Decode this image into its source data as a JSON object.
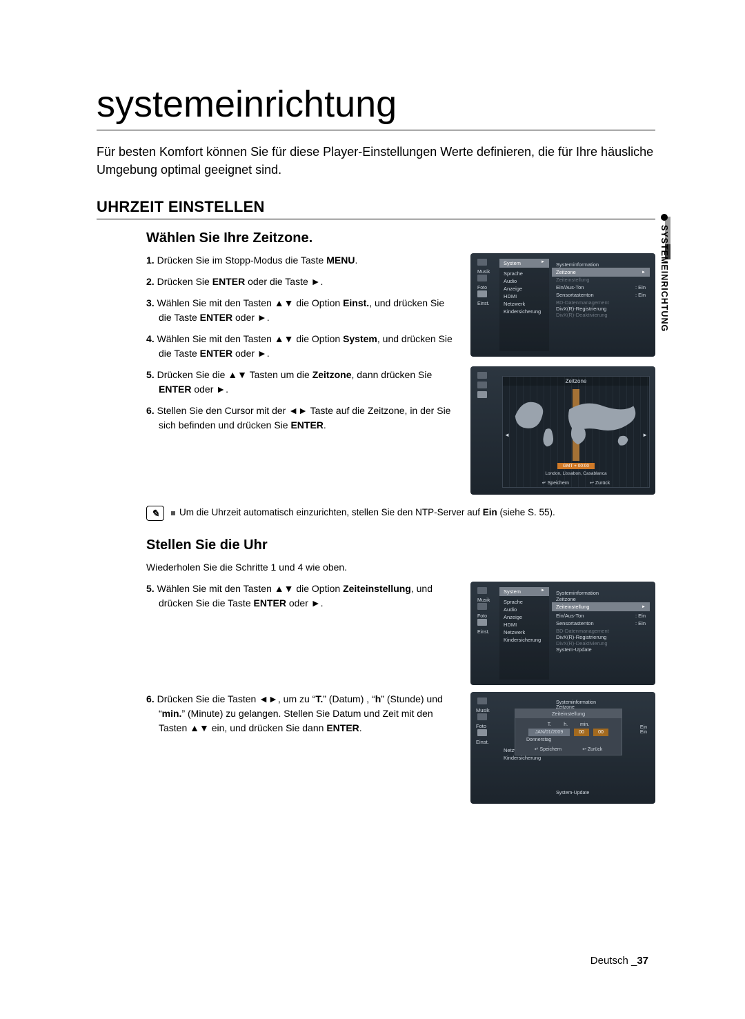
{
  "page": {
    "title": "systemeinrichtung",
    "intro": "Für besten Komfort können Sie für diese Player-Einstellungen Werte definieren, die für Ihre häusliche Umgebung optimal geeignet sind.",
    "sidebar_label": "SYSTEMEINRICHTUNG",
    "footer_lang": "Deutsch",
    "footer_page": "37"
  },
  "s1": {
    "heading": "UHRZEIT EINSTELLEN",
    "sub1": "Wählen Sie Ihre Zeitzone.",
    "steps": {
      "n1": "1.",
      "t1a": "Drücken Sie im Stopp-Modus die Taste ",
      "t1b": "MENU",
      "t1c": ".",
      "n2": "2.",
      "t2a": "Drücken Sie ",
      "t2b": "ENTER",
      "t2c": " oder die Taste ►.",
      "n3": "3.",
      "t3a": "Wählen Sie mit den Tasten ▲▼ die Option ",
      "t3b": "Einst.",
      "t3c": ", und drücken Sie die Taste ",
      "t3d": "ENTER",
      "t3e": " oder ►.",
      "n4": "4.",
      "t4a": "Wählen Sie mit den Tasten ▲▼ die Option ",
      "t4b": "System",
      "t4c": ", und drücken Sie die Taste ",
      "t4d": "ENTER",
      "t4e": " oder ►.",
      "n5": "5.",
      "t5a": "Drücken Sie die ▲▼ Tasten um die ",
      "t5b": "Zeitzone",
      "t5c": ", dann drücken Sie ",
      "t5d": "ENTER",
      "t5e": " oder ►.",
      "n6": "6.",
      "t6a": "Stellen Sie den Cursor mit der ◄► Taste auf die Zeitzone, in der Sie sich befinden und drücken Sie ",
      "t6b": "ENTER",
      "t6c": "."
    },
    "note": {
      "a": "Um die Uhrzeit automatisch einzurichten, stellen Sie den NTP-Server auf ",
      "b": "Ein",
      "c": " (siehe S. 55)."
    },
    "sub2": "Stellen Sie die Uhr",
    "repeat": "Wiederholen Sie die Schritte 1 und 4 wie oben.",
    "steps2": {
      "n5": "5.",
      "t5a": "Wählen Sie mit den Tasten ▲▼ die Option ",
      "t5b": "Zeiteinstellung",
      "t5c": ", und drücken Sie die Taste ",
      "t5d": "ENTER",
      "t5e": " oder ►.",
      "n6": "6.",
      "t6a": "Drücken Sie die Tasten ◄►, um zu “",
      "t6b": "T.",
      "t6c": "” (Datum) , “",
      "t6d": "h",
      "t6e": "” (Stunde) und  “",
      "t6f": "min.",
      "t6g": "”  (Minute) zu gelangen. Stellen Sie Datum und Zeit mit den Tasten ▲▼ ein, und drücken Sie dann ",
      "t6h": "ENTER",
      "t6i": "."
    }
  },
  "osd": {
    "menu_left": {
      "musik": "Musik",
      "foto": "Foto",
      "einst": "Einst."
    },
    "mid_items": {
      "system": "System",
      "sprache": "Sprache",
      "audio": "Audio",
      "anzeige": "Anzeige",
      "hdmi": "HDMI",
      "netzwerk": "Netzwerk",
      "kinder": "Kindersicherung"
    },
    "r1_items": {
      "si": "Systeminformation",
      "zz": "Zeitzone",
      "ze": "Zeiteinstellung",
      "eat": "Ein/Aus-Ton",
      "eat_v": ": Ein",
      "st": "Sensortastenton",
      "st_v": ": Ein",
      "bd": "BD-Datenmanagement",
      "divx": "DivX(R)-Registrierung",
      "deact": "DivX(R)-Deaktivierung"
    },
    "r2_extra": {
      "sysu": "System-Update"
    },
    "map": {
      "title": "Zeitzone",
      "gmt": "GMT + 00:00",
      "city": "London, Lissabon, Casablanca",
      "save": "Speichern",
      "back": "Zurück",
      "save_icon": "↵",
      "back_icon": "↩",
      "tri": "►"
    },
    "pop": {
      "title": "Zeiteinstellung",
      "h1": "T.",
      "h2": "h.",
      "h3": "min.",
      "date": "JAN/01/2009",
      "hh": "00",
      "mm": "00",
      "day": "Donnerstag",
      "save": "Speichern",
      "back": "Zurück",
      "ein1": "Ein",
      "ein2": "Ein"
    }
  }
}
